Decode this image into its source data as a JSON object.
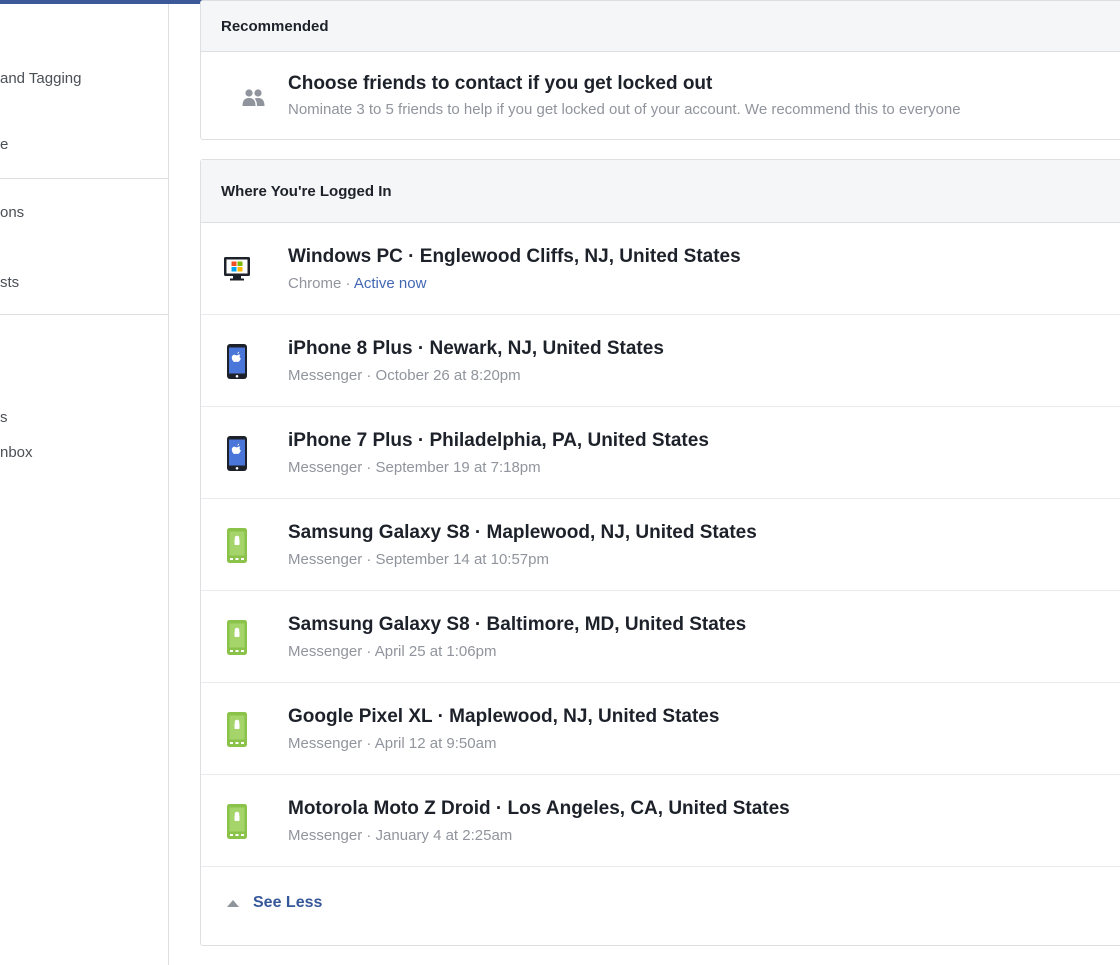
{
  "sidebar": {
    "items": [
      {
        "label": "and Tagging"
      },
      {
        "label": "e"
      },
      {
        "label": "ons"
      },
      {
        "label": "sts"
      },
      {
        "label": "s"
      },
      {
        "label": "nbox"
      }
    ]
  },
  "recommended": {
    "header": "Recommended",
    "item": {
      "icon": "people-icon",
      "title": "Choose friends to contact if you get locked out",
      "description": "Nominate 3 to 5 friends to help if you get locked out of your account. We recommend this to everyone"
    }
  },
  "sessions": {
    "header": "Where You're Logged In",
    "items": [
      {
        "icon": "desktop-windows-icon",
        "title": "Windows PC · Englewood Cliffs, NJ, United States",
        "app": "Chrome",
        "separator": " · ",
        "time": "Active now",
        "active": true
      },
      {
        "icon": "iphone-icon",
        "title": "iPhone 8 Plus · Newark, NJ, United States",
        "app": "Messenger",
        "separator": " · ",
        "time": "October 26 at 8:20pm",
        "active": false
      },
      {
        "icon": "iphone-icon",
        "title": "iPhone 7 Plus · Philadelphia, PA, United States",
        "app": "Messenger",
        "separator": " · ",
        "time": "September 19 at 7:18pm",
        "active": false
      },
      {
        "icon": "android-phone-icon",
        "title": "Samsung Galaxy S8 · Maplewood, NJ, United States",
        "app": "Messenger",
        "separator": " · ",
        "time": "September 14 at 10:57pm",
        "active": false
      },
      {
        "icon": "android-phone-icon",
        "title": "Samsung Galaxy S8 · Baltimore, MD, United States",
        "app": "Messenger",
        "separator": " · ",
        "time": "April 25 at 1:06pm",
        "active": false
      },
      {
        "icon": "android-phone-icon",
        "title": "Google Pixel XL · Maplewood, NJ, United States",
        "app": "Messenger",
        "separator": " · ",
        "time": "April 12 at 9:50am",
        "active": false
      },
      {
        "icon": "android-phone-icon",
        "title": "Motorola Moto Z Droid · Los Angeles, CA, United States",
        "app": "Messenger",
        "separator": " · ",
        "time": "January 4 at 2:25am",
        "active": false
      }
    ],
    "see_less": "See Less"
  },
  "colors": {
    "accent": "#3b5998",
    "link": "#4267b2",
    "iphone_blue": "#4a76d9",
    "android_green": "#8bc34a"
  }
}
